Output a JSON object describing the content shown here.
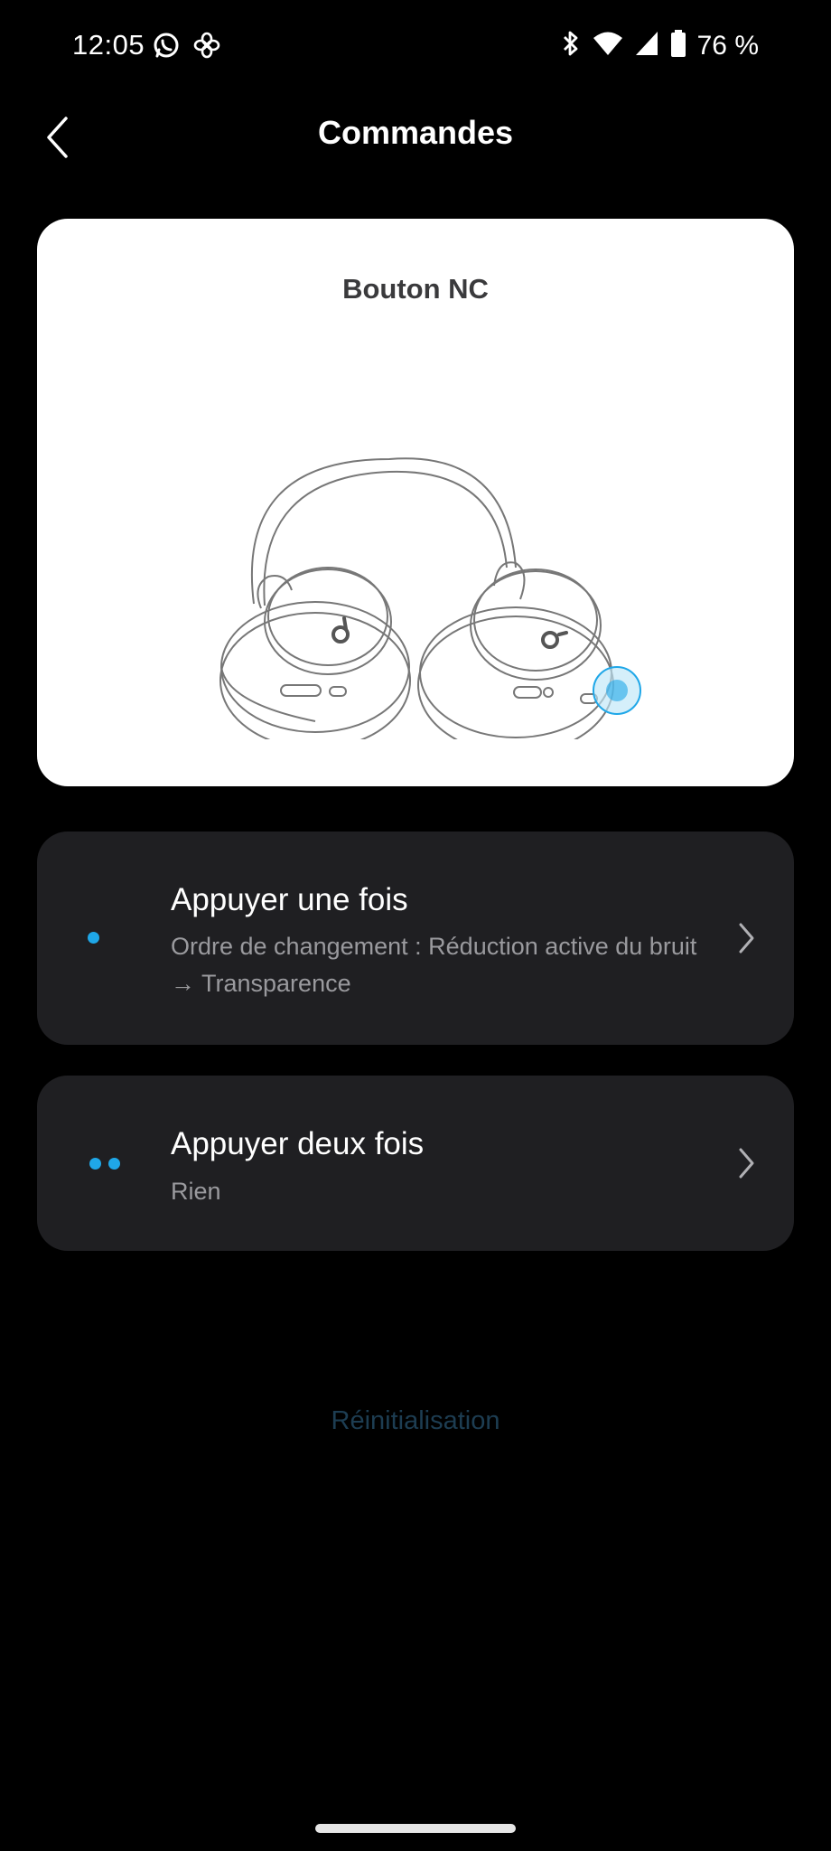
{
  "status_bar": {
    "time": "12:05",
    "left_icons": [
      "whatsapp-icon",
      "flower-icon"
    ],
    "right_icons": [
      "bluetooth-icon",
      "wifi-icon",
      "cell-signal-icon",
      "battery-icon"
    ],
    "battery": "76 %"
  },
  "header": {
    "title": "Commandes",
    "back_icon": "chevron-left-icon"
  },
  "image_card": {
    "title": "Bouton NC",
    "illustration": "headphones-illustration",
    "highlight_color": "#1fa7e8"
  },
  "options": [
    {
      "title": "Appuyer une fois",
      "subtitle": "Ordre de changement : Réduction active du bruit → Transparence",
      "indicator_dots": 1
    },
    {
      "title": "Appuyer deux fois",
      "subtitle": "Rien",
      "indicator_dots": 2
    }
  ],
  "reset_label": "Réinitialisation",
  "colors": {
    "accent": "#1fa7e8",
    "card_bg": "#1f1f22",
    "background": "#000000"
  }
}
